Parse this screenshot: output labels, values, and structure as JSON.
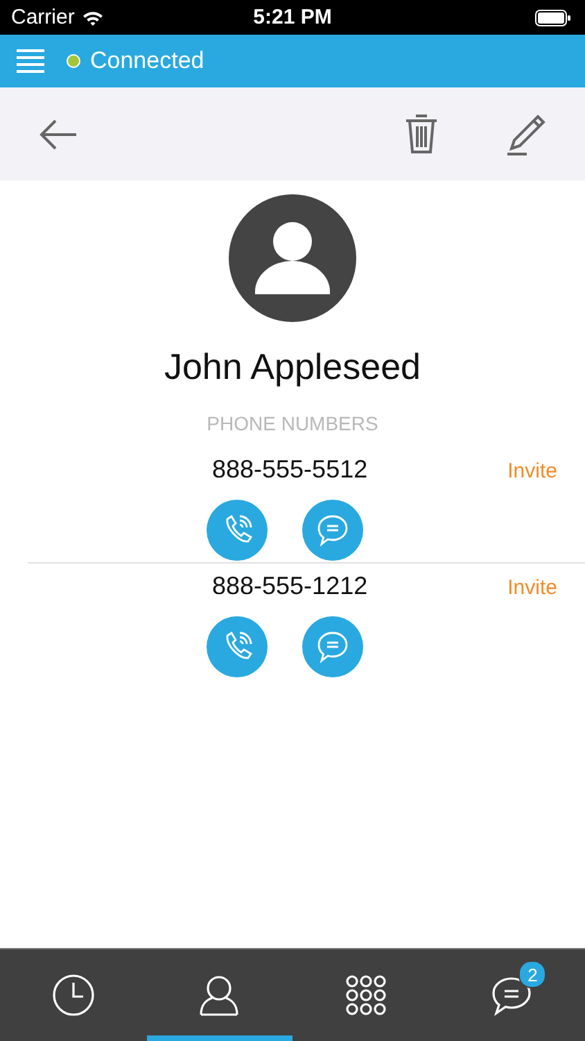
{
  "status_bar": {
    "carrier": "Carrier",
    "time": "5:21 PM"
  },
  "header": {
    "connection": {
      "label": "Connected",
      "online": true
    }
  },
  "contact": {
    "name": "John Appleseed",
    "section_title": "PHONE NUMBERS",
    "phones": [
      {
        "number": "888-555-5512",
        "invite": "Invite"
      },
      {
        "number": "888-555-1212",
        "invite": "Invite"
      }
    ]
  },
  "tabs": [
    {
      "kind": "recents",
      "selected": false
    },
    {
      "kind": "contacts",
      "selected": true
    },
    {
      "kind": "keypad",
      "selected": false
    },
    {
      "kind": "messages",
      "selected": false,
      "badge": "2"
    }
  ]
}
